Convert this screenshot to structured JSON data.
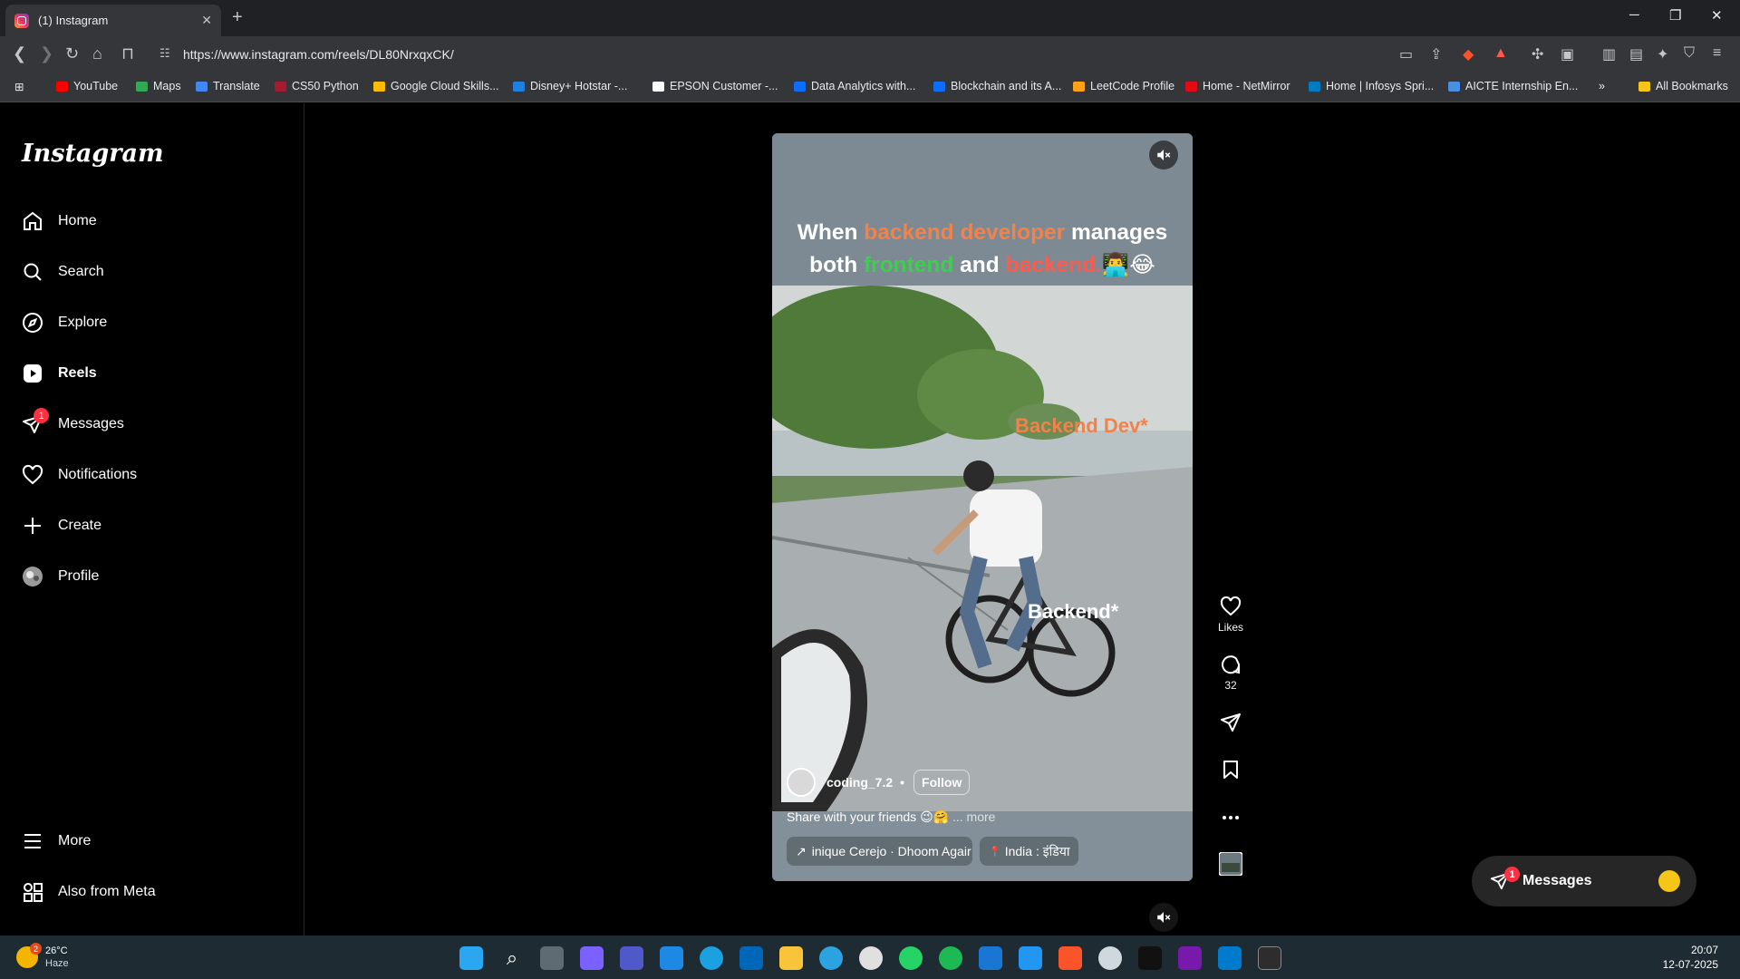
{
  "browser": {
    "tab_title": "(1) Instagram",
    "url": "https://www.instagram.com/reels/DL80NrxqxCK/",
    "bookmarks": [
      {
        "label": "YouTube",
        "color": "#ff0000"
      },
      {
        "label": "Maps",
        "color": "#34a853"
      },
      {
        "label": "Translate",
        "color": "#4285f4"
      },
      {
        "label": "CS50 Python",
        "color": "#a51c30"
      },
      {
        "label": "Google Cloud Skills...",
        "color": "#fbbc05"
      },
      {
        "label": "Disney+ Hotstar -...",
        "color": "#1f80e0"
      },
      {
        "label": "EPSON Customer -...",
        "color": "#ffffff"
      },
      {
        "label": "Data Analytics with...",
        "color": "#0d6efd"
      },
      {
        "label": "Blockchain and its A...",
        "color": "#0d6efd"
      },
      {
        "label": "LeetCode Profile",
        "color": "#ffa116"
      },
      {
        "label": "Home - NetMirror",
        "color": "#e50914"
      },
      {
        "label": "Home | Infosys Spri...",
        "color": "#007cc3"
      },
      {
        "label": "AICTE Internship En...",
        "color": "#4a90e2"
      }
    ],
    "all_bookmarks": "All Bookmarks"
  },
  "sidebar": {
    "logo": "Instagram",
    "items": [
      {
        "label": "Home"
      },
      {
        "label": "Search"
      },
      {
        "label": "Explore"
      },
      {
        "label": "Reels"
      },
      {
        "label": "Messages",
        "badge": "1"
      },
      {
        "label": "Notifications"
      },
      {
        "label": "Create"
      },
      {
        "label": "Profile"
      }
    ],
    "bottom": [
      {
        "label": "More"
      },
      {
        "label": "Also from Meta"
      }
    ]
  },
  "reel": {
    "text_line1_a": "When ",
    "text_line1_b": "backend developer",
    "text_line1_c": " manages",
    "text_line2_a": "both ",
    "text_line2_b": "frontend",
    "text_line2_c": " and ",
    "text_line2_d": "backend.",
    "text_line2_e": "👨‍💻😂",
    "label_backend_dev": "Backend Dev*",
    "label_backend": "Backend*",
    "author": "coding_7.2",
    "dot": "•",
    "follow": "Follow",
    "caption": "Share with your friends 😉🤗",
    "caption_more": "... more",
    "audio": "inique Cerejo · Dhoom Agair",
    "location": "India : इंडिया"
  },
  "actions": {
    "likes": "Likes",
    "comments": "32"
  },
  "messages_float": {
    "label": "Messages",
    "badge": "1"
  },
  "taskbar": {
    "temp": "26°C",
    "condition": "Haze",
    "weather_badge": "2",
    "time": "20:07",
    "date": "12-07-2025"
  },
  "colors": {
    "accent_orange": "#f2824a",
    "accent_green": "#3ccf4e",
    "accent_red": "#ff5a4e",
    "notification": "#ff3040"
  }
}
